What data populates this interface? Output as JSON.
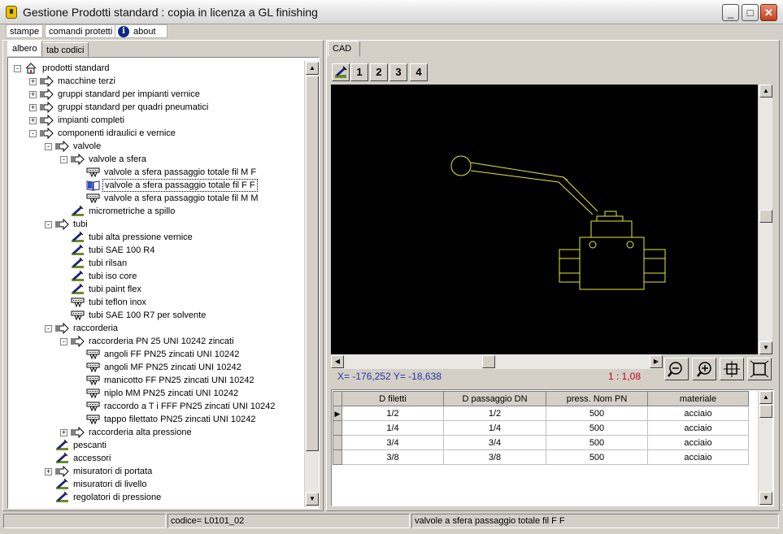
{
  "window": {
    "title": "Gestione Prodotti standard : copia in licenza a GL finishing",
    "minimize": "_",
    "maximize": "□",
    "close": "✕"
  },
  "menu": {
    "stampe": "stampe",
    "comandi": "comandi protetti",
    "about": "about",
    "about_icon": "i"
  },
  "left_tabs": {
    "albero": "albero",
    "tab_codici": "tab  codici"
  },
  "right_tab": "CAD",
  "tree": [
    {
      "label": "prodotti standard",
      "level": 0,
      "expander": "-",
      "icon": "home-icon"
    },
    {
      "label": "macchine terzi",
      "level": 1,
      "expander": "+",
      "icon": "group-arrow-icon"
    },
    {
      "label": "gruppi standard per impianti vernice",
      "level": 1,
      "expander": "+",
      "icon": "group-arrow-icon"
    },
    {
      "label": "gruppi standard per quadri pneumatici",
      "level": 1,
      "expander": "+",
      "icon": "group-arrow-icon"
    },
    {
      "label": "impianti completi",
      "level": 1,
      "expander": "+",
      "icon": "group-arrow-icon"
    },
    {
      "label": "componenti idraulici e vernice",
      "level": 1,
      "expander": "-",
      "icon": "group-arrow-icon"
    },
    {
      "label": "valvole",
      "level": 2,
      "expander": "-",
      "icon": "group-arrow-icon"
    },
    {
      "label": "valvole a sfera",
      "level": 3,
      "expander": "-",
      "icon": "group-arrow-icon"
    },
    {
      "label": "valvole a sfera passaggio totale  fil M F",
      "level": 4,
      "expander": "",
      "icon": "part-icon"
    },
    {
      "label": "valvole a sfera passaggio totale  fil F F",
      "level": 4,
      "expander": "",
      "icon": "book-icon",
      "selected": true
    },
    {
      "label": "valvole a sfera passaggio totale  fil M M",
      "level": 4,
      "expander": "",
      "icon": "part-icon"
    },
    {
      "label": "micrometriche a spillo",
      "level": 3,
      "expander": "",
      "icon": "drawing-icon"
    },
    {
      "label": "tubi",
      "level": 2,
      "expander": "-",
      "icon": "group-arrow-icon"
    },
    {
      "label": "tubi alta pressione vernice",
      "level": 3,
      "expander": "",
      "icon": "drawing-icon"
    },
    {
      "label": "tubi SAE 100 R4",
      "level": 3,
      "expander": "",
      "icon": "drawing-icon"
    },
    {
      "label": "tubi rilsan",
      "level": 3,
      "expander": "",
      "icon": "drawing-icon"
    },
    {
      "label": "tubi iso core",
      "level": 3,
      "expander": "",
      "icon": "drawing-icon"
    },
    {
      "label": "tubi paint flex",
      "level": 3,
      "expander": "",
      "icon": "drawing-icon"
    },
    {
      "label": "tubi teflon inox",
      "level": 3,
      "expander": "",
      "icon": "part-icon"
    },
    {
      "label": "tubi SAE 100 R7 per solvente",
      "level": 3,
      "expander": "",
      "icon": "part-icon"
    },
    {
      "label": "raccorderia",
      "level": 2,
      "expander": "-",
      "icon": "group-arrow-icon"
    },
    {
      "label": "raccorderia PN 25 UNI 10242 zincati",
      "level": 3,
      "expander": "-",
      "icon": "group-arrow-icon"
    },
    {
      "label": "angoli FF PN25 zincati UNI 10242",
      "level": 4,
      "expander": "",
      "icon": "part-icon"
    },
    {
      "label": "angoli MF PN25 zincati UNI 10242",
      "level": 4,
      "expander": "",
      "icon": "part-icon"
    },
    {
      "label": "manicotto FF PN25 zincati UNI 10242",
      "level": 4,
      "expander": "",
      "icon": "part-icon"
    },
    {
      "label": "niplo MM  PN25 zincati UNI 10242",
      "level": 4,
      "expander": "",
      "icon": "part-icon"
    },
    {
      "label": "raccordo a T i FFF PN25 zincati UNI 10242",
      "level": 4,
      "expander": "",
      "icon": "part-icon"
    },
    {
      "label": "tappo filettato  PN25 zincati UNI 10242",
      "level": 4,
      "expander": "",
      "icon": "part-icon"
    },
    {
      "label": "raccorderia alta pressione",
      "level": 3,
      "expander": "+",
      "icon": "group-arrow-icon"
    },
    {
      "label": "pescanti",
      "level": 2,
      "expander": "",
      "icon": "drawing-icon"
    },
    {
      "label": "accessori",
      "level": 2,
      "expander": "",
      "icon": "drawing-icon"
    },
    {
      "label": "misuratori di portata",
      "level": 2,
      "expander": "+",
      "icon": "group-arrow-icon"
    },
    {
      "label": "misuratori di livello",
      "level": 2,
      "expander": "",
      "icon": "drawing-icon"
    },
    {
      "label": "regolatori di pressione",
      "level": 2,
      "expander": "",
      "icon": "drawing-icon"
    }
  ],
  "cad_toolbar": {
    "b1": "1",
    "b2": "2",
    "b3": "3",
    "b4": "4"
  },
  "cad": {
    "coords": "X= -176,252   Y= -18,638",
    "scale": "1 : 1,08",
    "line_color": "#e8e838"
  },
  "table": {
    "columns": [
      "D filetti",
      "D passaggio DN",
      "press. Nom PN",
      "materiale"
    ],
    "rows": [
      [
        "1/2",
        "1/2",
        "500",
        "acciaio"
      ],
      [
        "1/4",
        "1/4",
        "500",
        "acciaio"
      ],
      [
        "3/4",
        "3/4",
        "500",
        "acciaio"
      ],
      [
        "3/8",
        "3/8",
        "500",
        "acciaio"
      ]
    ],
    "current_row": 0
  },
  "status": {
    "codice": "codice= L0101_02",
    "descrizione": "valvole a sfera passaggio totale  fil F F"
  }
}
